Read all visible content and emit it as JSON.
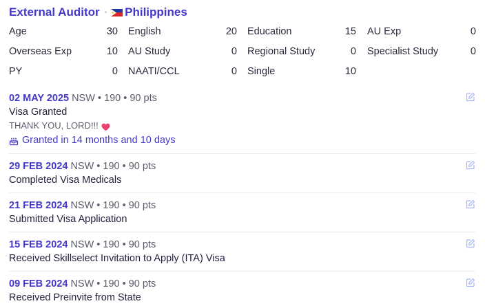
{
  "header": {
    "role": "External Auditor",
    "separator": "•",
    "country": "Philippines",
    "flag_icon": "philippines-flag-icon"
  },
  "stats": [
    [
      {
        "label": "Age",
        "value": "30"
      },
      {
        "label": "English",
        "value": "20"
      },
      {
        "label": "Education",
        "value": "15"
      },
      {
        "label": "AU Exp",
        "value": "0"
      }
    ],
    [
      {
        "label": "Overseas Exp",
        "value": "10"
      },
      {
        "label": "AU Study",
        "value": "0"
      },
      {
        "label": "Regional Study",
        "value": "0"
      },
      {
        "label": "Specialist Study",
        "value": "0"
      }
    ],
    [
      {
        "label": "PY",
        "value": "0"
      },
      {
        "label": "NAATI/CCL",
        "value": "0"
      },
      {
        "label": "Single",
        "value": "10"
      }
    ]
  ],
  "timeline": [
    {
      "date": "02 MAY 2025",
      "meta": "NSW • 190 • 90 pts",
      "title": "Visa Granted",
      "note": "THANK YOU, LORD!!!",
      "granted": "Granted in 14 months and 10 days"
    },
    {
      "date": "29 FEB 2024",
      "meta": "NSW • 190 • 90 pts",
      "title": "Completed Visa Medicals"
    },
    {
      "date": "21 FEB 2024",
      "meta": "NSW • 190 • 90 pts",
      "title": "Submitted Visa Application"
    },
    {
      "date": "15 FEB 2024",
      "meta": "NSW • 190 • 90 pts",
      "title": "Received Skillselect Invitation to Apply (ITA) Visa"
    },
    {
      "date": "09 FEB 2024",
      "meta": "NSW • 190 • 90 pts",
      "title": "Received Preinvite from State"
    }
  ],
  "colors": {
    "accent": "#4338ca",
    "heart": "#e8436e",
    "edit_icon": "#a5b4fc"
  }
}
